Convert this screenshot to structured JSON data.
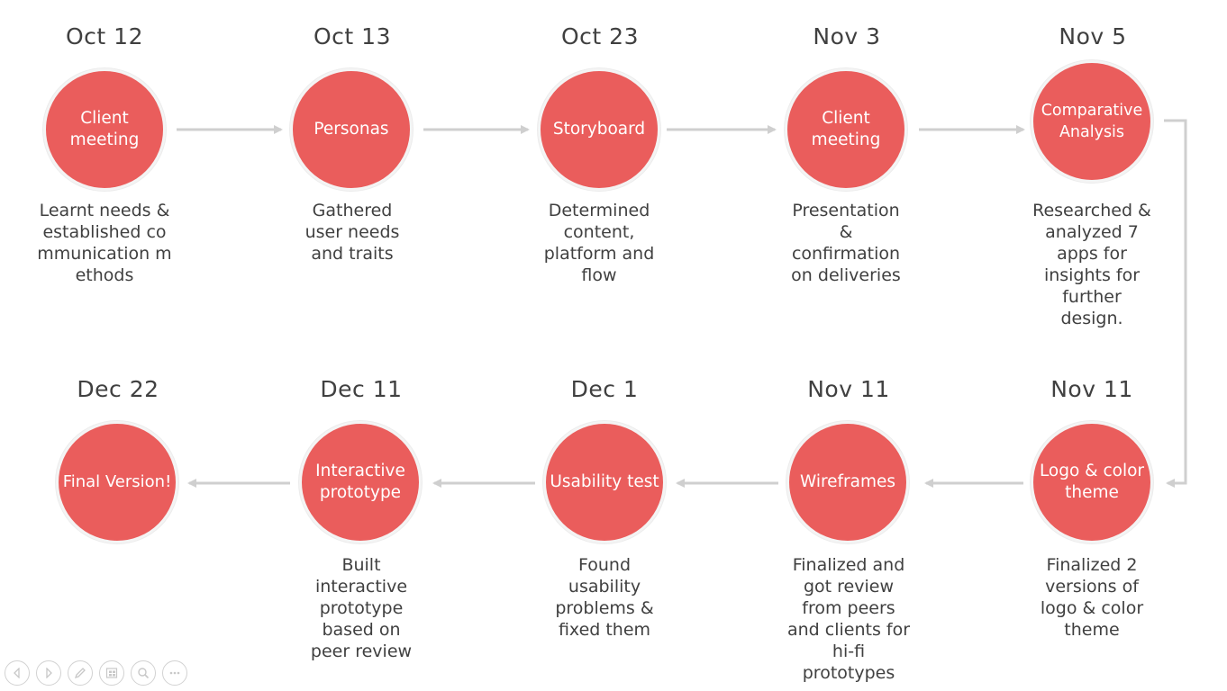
{
  "milestones": [
    {
      "date": "Oct 12",
      "label": "Client meeting",
      "desc": "Learnt needs & established communication methods"
    },
    {
      "date": "Oct 13",
      "label": "Personas",
      "desc": "Gathered user needs and traits"
    },
    {
      "date": "Oct 23",
      "label": "Storyboard",
      "desc": "Determined content, platform and flow"
    },
    {
      "date": "Nov 3",
      "label": "Client meeting",
      "desc": "Presentation & confirmation on deliveries"
    },
    {
      "date": "Nov 5",
      "label": "Comparative Analysis",
      "desc": "Researched & analyzed 7 apps for insights for further design."
    },
    {
      "date": "Nov 11",
      "label": "Logo & color theme",
      "desc": "Finalized 2 versions of logo & color theme"
    },
    {
      "date": "Nov 11",
      "label": "Wireframes",
      "desc": "Finalized and got review from peers and clients for hi-fi prototypes"
    },
    {
      "date": "Dec 1",
      "label": "Usability test",
      "desc": "Found usability problems & fixed them"
    },
    {
      "date": "Dec 11",
      "label": "Interactive prototype",
      "desc": "Built interactive prototype based on peer review"
    },
    {
      "date": "Dec 22",
      "label": "Final Version!",
      "desc": ""
    }
  ],
  "colors": {
    "circle": "#ea5d5c",
    "arrow": "#cfcfcf",
    "text": "#404040"
  },
  "slideshow_controls": [
    "previous-icon",
    "next-icon",
    "pen-icon",
    "slides-icon",
    "zoom-icon",
    "more-icon"
  ]
}
